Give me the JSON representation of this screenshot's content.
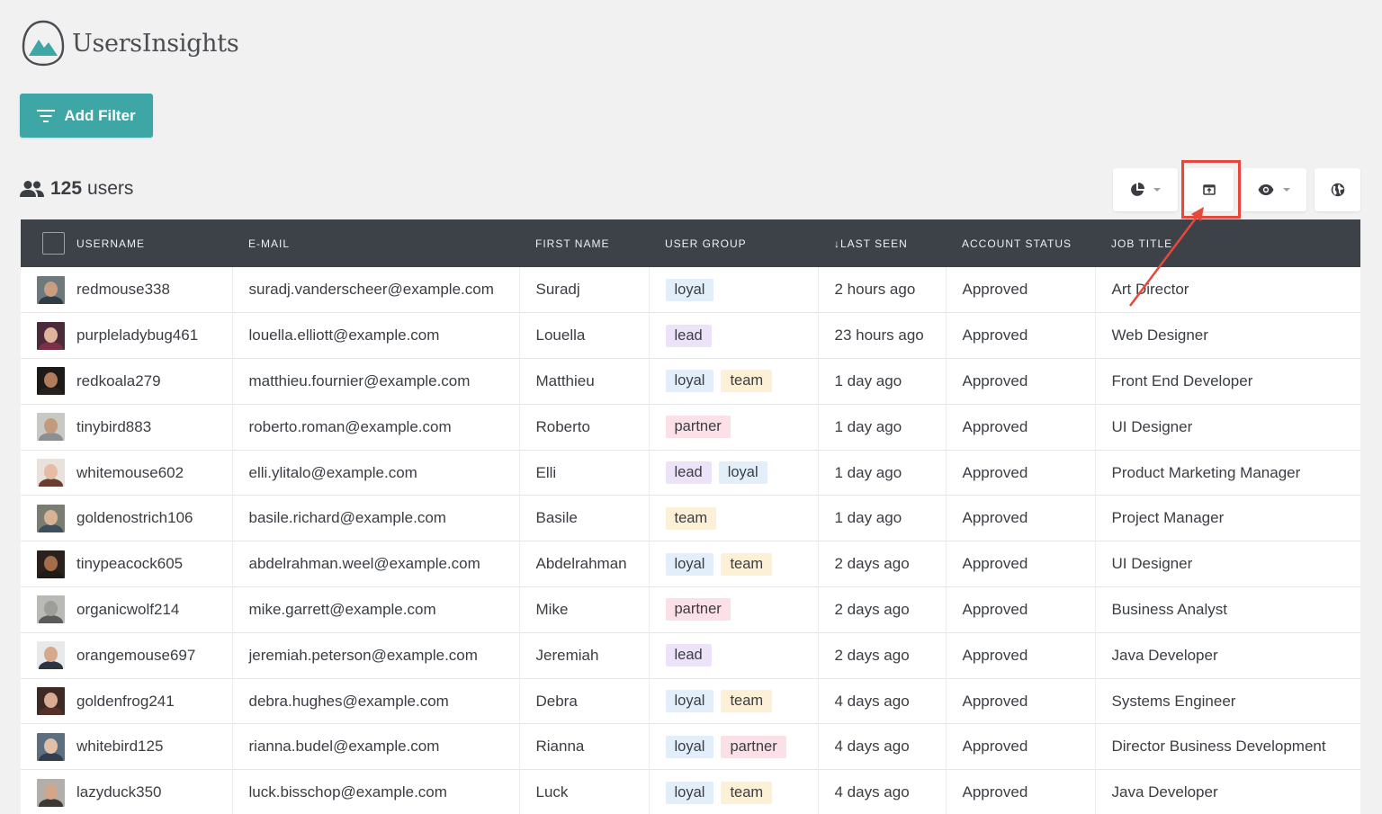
{
  "app": {
    "logo_text": "UsersInsights",
    "add_filter_label": "Add Filter"
  },
  "summary": {
    "count": "125",
    "label": "users"
  },
  "toolbar": {
    "icons": [
      "segments-pie-icon",
      "export-icon",
      "visibility-eye-icon",
      "globe-icon"
    ]
  },
  "colors": {
    "accent": "#3fa6a6",
    "header_bg": "#3d4148",
    "highlight": "#e8473b",
    "tag_loyal_bg": "#e3eefb",
    "tag_lead_bg": "#ece3f8",
    "tag_team_bg": "#fcf1d7",
    "tag_partner_bg": "#fbe0e8"
  },
  "table": {
    "columns": [
      "Username",
      "E-mail",
      "First Name",
      "User Group",
      "↓Last Seen",
      "Account Status",
      "Job Title"
    ],
    "rows": [
      {
        "username": "redmouse338",
        "email": "suradj.vanderscheer@example.com",
        "first_name": "Suradj",
        "groups": [
          "loyal"
        ],
        "last_seen": "2 hours ago",
        "status": "Approved",
        "job": "Art Director",
        "avatar": {
          "bg": "#6c7a7e",
          "skin": "#c99d7f",
          "shirt": "#2f3d48"
        }
      },
      {
        "username": "purpleladybug461",
        "email": "louella.elliott@example.com",
        "first_name": "Louella",
        "groups": [
          "lead"
        ],
        "last_seen": "23 hours ago",
        "status": "Approved",
        "job": "Web Designer",
        "avatar": {
          "bg": "#4b2b3a",
          "skin": "#e0b39c",
          "shirt": "#7a3048"
        }
      },
      {
        "username": "redkoala279",
        "email": "matthieu.fournier@example.com",
        "first_name": "Matthieu",
        "groups": [
          "loyal",
          "team"
        ],
        "last_seen": "1 day ago",
        "status": "Approved",
        "job": "Front End Developer",
        "avatar": {
          "bg": "#1e1a18",
          "skin": "#b07c5c",
          "shirt": "#26211d"
        }
      },
      {
        "username": "tinybird883",
        "email": "roberto.roman@example.com",
        "first_name": "Roberto",
        "groups": [
          "partner"
        ],
        "last_seen": "1 day ago",
        "status": "Approved",
        "job": "UI Designer",
        "avatar": {
          "bg": "#c9c9c4",
          "skin": "#c49a7e",
          "shirt": "#8c8f90"
        }
      },
      {
        "username": "whitemouse602",
        "email": "elli.ylitalo@example.com",
        "first_name": "Elli",
        "groups": [
          "lead",
          "loyal"
        ],
        "last_seen": "1 day ago",
        "status": "Approved",
        "job": "Product Marketing Manager",
        "avatar": {
          "bg": "#e9e2dc",
          "skin": "#e6bca4",
          "shirt": "#6b3d2e"
        }
      },
      {
        "username": "goldenostrich106",
        "email": "basile.richard@example.com",
        "first_name": "Basile",
        "groups": [
          "team"
        ],
        "last_seen": "1 day ago",
        "status": "Approved",
        "job": "Project Manager",
        "avatar": {
          "bg": "#7a7e72",
          "skin": "#d8b294",
          "shirt": "#3d4e5c"
        }
      },
      {
        "username": "tinypeacock605",
        "email": "abdelrahman.weel@example.com",
        "first_name": "Abdelrahman",
        "groups": [
          "loyal",
          "team"
        ],
        "last_seen": "2 days ago",
        "status": "Approved",
        "job": "UI Designer",
        "avatar": {
          "bg": "#2a211c",
          "skin": "#a36d4c",
          "shirt": "#1d1a18"
        }
      },
      {
        "username": "organicwolf214",
        "email": "mike.garrett@example.com",
        "first_name": "Mike",
        "groups": [
          "partner"
        ],
        "last_seen": "2 days ago",
        "status": "Approved",
        "job": "Business Analyst",
        "avatar": {
          "bg": "#b9b9b6",
          "skin": "#9d9d9a",
          "shirt": "#5b5b5a"
        }
      },
      {
        "username": "orangemouse697",
        "email": "jeremiah.peterson@example.com",
        "first_name": "Jeremiah",
        "groups": [
          "lead"
        ],
        "last_seen": "2 days ago",
        "status": "Approved",
        "job": "Java Developer",
        "avatar": {
          "bg": "#e7e9ea",
          "skin": "#d6a98b",
          "shirt": "#2b3440"
        }
      },
      {
        "username": "goldenfrog241",
        "email": "debra.hughes@example.com",
        "first_name": "Debra",
        "groups": [
          "loyal",
          "team"
        ],
        "last_seen": "4 days ago",
        "status": "Approved",
        "job": "Systems Engineer",
        "avatar": {
          "bg": "#3e2a24",
          "skin": "#d9ab92",
          "shirt": "#54302a"
        }
      },
      {
        "username": "whitebird125",
        "email": "rianna.budel@example.com",
        "first_name": "Rianna",
        "groups": [
          "loyal",
          "partner"
        ],
        "last_seen": "4 days ago",
        "status": "Approved",
        "job": "Director Business Development",
        "avatar": {
          "bg": "#5d6e7e",
          "skin": "#e2c0a8",
          "shirt": "#2f3f50"
        }
      },
      {
        "username": "lazyduck350",
        "email": "luck.bisschop@example.com",
        "first_name": "Luck",
        "groups": [
          "loyal",
          "team"
        ],
        "last_seen": "4 days ago",
        "status": "Approved",
        "job": "Java Developer",
        "avatar": {
          "bg": "#b3aea9",
          "skin": "#d3a58a",
          "shirt": "#3c3836"
        }
      }
    ]
  }
}
